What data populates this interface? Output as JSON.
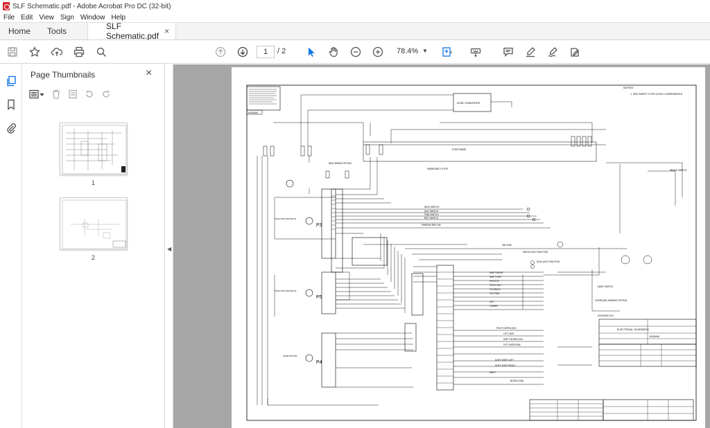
{
  "window": {
    "title": "SLF Schematic.pdf - Adobe Acrobat Pro DC (32-bit)"
  },
  "menu": [
    "File",
    "Edit",
    "View",
    "Sign",
    "Window",
    "Help"
  ],
  "tabs": {
    "home": "Home",
    "tools": "Tools",
    "document": "SLF Schematic.pdf",
    "close": "×"
  },
  "toolbar": {
    "page_current": "1",
    "page_total": "/ 2",
    "zoom": "78.4%"
  },
  "thumbnails": {
    "header": "Page Thumbnails",
    "close": "×",
    "pages": [
      {
        "label": "1"
      },
      {
        "label": "2"
      }
    ]
  },
  "schematic": {
    "notes_title": "NOTES:",
    "notes_1": "1.  SEE SHEET 2 FOR 12VDC COMPONENTS.",
    "converter": "DC/DC CONVERTER",
    "fuse_panel": "FUSE PANEL",
    "drawing_no": "1415446",
    "title": "ELECTRICAL SCHEMATIC",
    "seat_brake": "SEAT BRAKE OPTION",
    "brake_switch": "BRAKE SWITCH",
    "motor_p3": "P3",
    "motor_p5": "P5",
    "motor_p4": "P4",
    "traction_motor_1": "TRACTION MOTOR #1",
    "traction_motor_2": "TRACTION MOTOR #2",
    "pump_motor": "PUMP MOTOR",
    "seat_switch": "SEAT SWITCH",
    "aux_switch": "AUX SWITCH",
    "fwd_switch": "FWD SWITCH",
    "rev_switch": "REV SWITCH",
    "parking_brk": "PARKING BRK SW",
    "single_aux": "SINGLE AUX FUNCTION",
    "dual_aux": "DUAL AUX FUNCTION",
    "shift_right": "SHIFT RIGHT",
    "shift_left": "SHIFT LEFT",
    "pivot_in": "PIVOT IN",
    "pivot_out": "PIVOT OUT",
    "tilt_back": "TILT BACK",
    "tilt_fwd": "TILT FWD",
    "lift": "LIFT",
    "lower": "LOWER",
    "pivot_interlock": "PIVOT INTERLOCK",
    "lift_limit": "LIFT LIMIT",
    "shift_interlock": "SHIFT INTERLOCK",
    "lift_over_ride": "LIFT OVER RIDE",
    "soft_shift_left": "SOFT SHIFT LEFT",
    "soft_shift_right": "SOFT SHIFT RIGHT",
    "shift": "SHIFT",
    "boom_load": "BOOM LOAD",
    "emergency_stop": "EMERGENCY STOP",
    "overload": "OVERLOAD SENSING OPTION",
    "mast_switch": "MAST SWITCH",
    "solenoid": "SOLENOID VLV",
    "resistor": "330 OHM"
  }
}
